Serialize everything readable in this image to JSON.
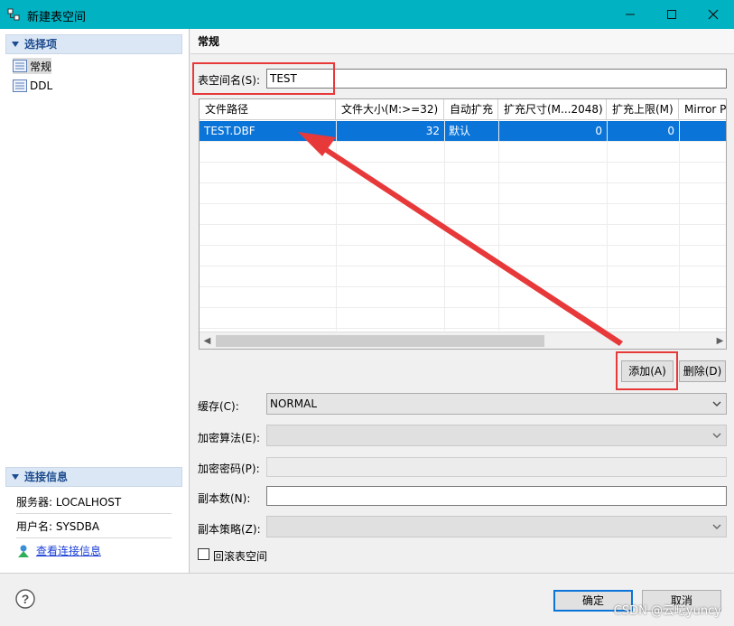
{
  "window": {
    "title": "新建表空间"
  },
  "left": {
    "selection_header": "选择项",
    "tree_items": [
      {
        "label": "常规",
        "icon": "document-icon"
      },
      {
        "label": "DDL",
        "icon": "document-icon"
      }
    ],
    "connection_header": "连接信息",
    "server": "服务器: LOCALHOST",
    "user": "用户名: SYSDBA",
    "view_link": "查看连接信息"
  },
  "main": {
    "section_title": "常规",
    "tablespace_label": "表空间名(S):",
    "tablespace_value": "TEST",
    "table": {
      "columns": [
        "文件路径",
        "文件大小(M:>=32)",
        "自动扩充",
        "扩充尺寸(M...2048)",
        "扩充上限(M)",
        "Mirror P"
      ],
      "rows": [
        {
          "path": "TEST.DBF",
          "size": "32",
          "auto": "默认",
          "ext_size": "0",
          "ext_limit": "0",
          "mirror": ""
        }
      ]
    },
    "add_button": "添加(A)",
    "delete_button": "删除(D)",
    "cache_label": "缓存(C):",
    "cache_value": "NORMAL",
    "encrypt_algo_label": "加密算法(E):",
    "encrypt_pwd_label": "加密密码(P):",
    "copies_label": "副本数(N):",
    "copy_policy_label": "副本策略(Z):",
    "rollback_label": "回滚表空间"
  },
  "footer": {
    "ok": "确定",
    "cancel": "取消",
    "watermark": "CSDN @云曦yuncy"
  },
  "colors": {
    "titlebar": "#00b2c2",
    "selection": "#0a74d8",
    "annotation": "#e8393a"
  }
}
